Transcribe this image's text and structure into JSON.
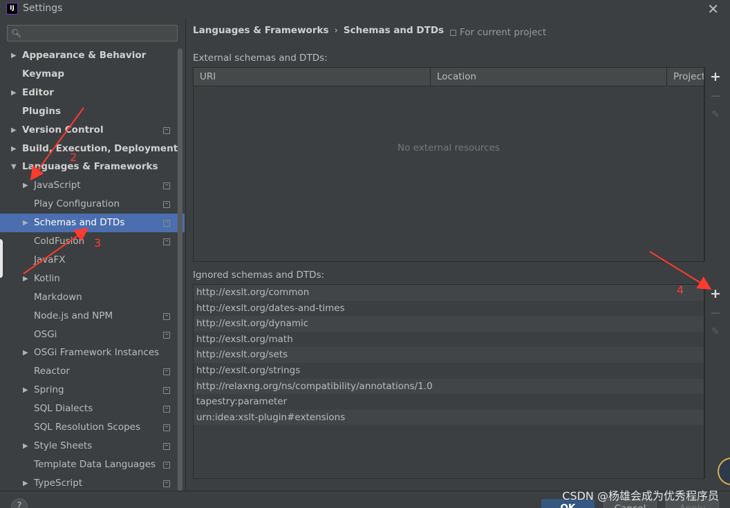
{
  "window": {
    "title": "Settings",
    "app_icon": "IJ",
    "close": "✕"
  },
  "search": {
    "placeholder": "",
    "icon": "search-icon"
  },
  "sidebar": {
    "items": [
      {
        "label": "Appearance & Behavior",
        "arrow": "▶",
        "bold": true
      },
      {
        "label": "Keymap",
        "arrow": "",
        "bold": true
      },
      {
        "label": "Editor",
        "arrow": "▶",
        "bold": true
      },
      {
        "label": "Plugins",
        "arrow": "",
        "bold": true
      },
      {
        "label": "Version Control",
        "arrow": "▶",
        "bold": true,
        "project": true
      },
      {
        "label": "Build, Execution, Deployment",
        "arrow": "▶",
        "bold": true
      },
      {
        "label": "Languages & Frameworks",
        "arrow": "▼",
        "bold": true
      },
      {
        "label": "JavaScript",
        "arrow": "▶",
        "project": true
      },
      {
        "label": "Play Configuration",
        "arrow": "",
        "project": true
      },
      {
        "label": "Schemas and DTDs",
        "arrow": "▶",
        "project": true,
        "selected": true
      },
      {
        "label": "ColdFusion",
        "arrow": "",
        "project": true
      },
      {
        "label": "JavaFX",
        "arrow": ""
      },
      {
        "label": "Kotlin",
        "arrow": "▶"
      },
      {
        "label": "Markdown",
        "arrow": ""
      },
      {
        "label": "Node.js and NPM",
        "arrow": "",
        "project": true
      },
      {
        "label": "OSGi",
        "arrow": "",
        "project": true
      },
      {
        "label": "OSGi Framework Instances",
        "arrow": "▶"
      },
      {
        "label": "Reactor",
        "arrow": "",
        "project": true
      },
      {
        "label": "Spring",
        "arrow": "▶",
        "project": true
      },
      {
        "label": "SQL Dialects",
        "arrow": "",
        "project": true
      },
      {
        "label": "SQL Resolution Scopes",
        "arrow": "",
        "project": true
      },
      {
        "label": "Style Sheets",
        "arrow": "▶",
        "project": true
      },
      {
        "label": "Template Data Languages",
        "arrow": "",
        "project": true
      },
      {
        "label": "TypeScript",
        "arrow": "▶",
        "project": true
      }
    ]
  },
  "header": {
    "crumb1": "Languages & Frameworks",
    "separator": "›",
    "crumb2": "Schemas and DTDs",
    "scope": "For current project"
  },
  "external": {
    "label": "External schemas and DTDs:",
    "columns": [
      "URI",
      "Location",
      "Project"
    ],
    "empty": "No external resources"
  },
  "ignored": {
    "label": "Ignored schemas and DTDs:",
    "rows": [
      "http://exslt.org/common",
      "http://exslt.org/dates-and-times",
      "http://exslt.org/dynamic",
      "http://exslt.org/math",
      "http://exslt.org/sets",
      "http://exslt.org/strings",
      "http://relaxng.org/ns/compatibility/annotations/1.0",
      "tapestry:parameter",
      "urn:idea:xslt-plugin#extensions"
    ]
  },
  "toolbar": {
    "add": "+",
    "remove": "−",
    "edit": "✎"
  },
  "footer": {
    "help": "?",
    "ok": "OK",
    "cancel": "Cancel",
    "apply": "Apply"
  },
  "annotations": [
    "2",
    "3",
    "4"
  ],
  "watermark": "CSDN @杨雄会成为优秀程序员",
  "colors": {
    "selection": "#4b6eaf",
    "annotation": "#ff3b30",
    "background": "#3c3f41"
  }
}
